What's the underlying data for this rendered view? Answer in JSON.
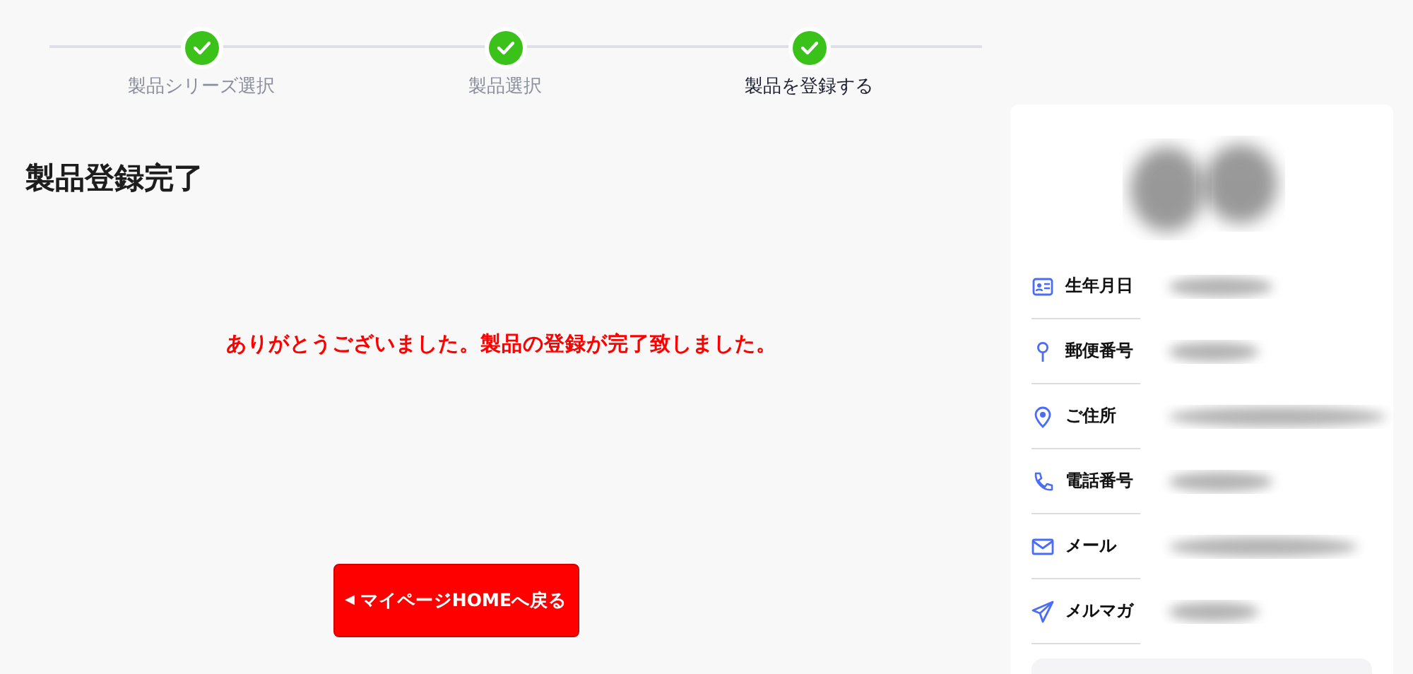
{
  "steps": [
    {
      "label": "製品シリーズ選択",
      "done": true,
      "current": false
    },
    {
      "label": "製品選択",
      "done": true,
      "current": false
    },
    {
      "label": "製品を登録する",
      "done": true,
      "current": true
    }
  ],
  "page_title": "製品登録完了",
  "message": "ありがとうございました。製品の登録が完了致しました。",
  "back_button": {
    "icon": "◀",
    "label": "マイページHOMEへ戻る"
  },
  "profile": {
    "fields": [
      {
        "label": "生年月日"
      },
      {
        "label": "郵便番号"
      },
      {
        "label": "ご住所"
      },
      {
        "label": "電話番号"
      },
      {
        "label": "メール"
      },
      {
        "label": "メルマガ"
      }
    ]
  }
}
